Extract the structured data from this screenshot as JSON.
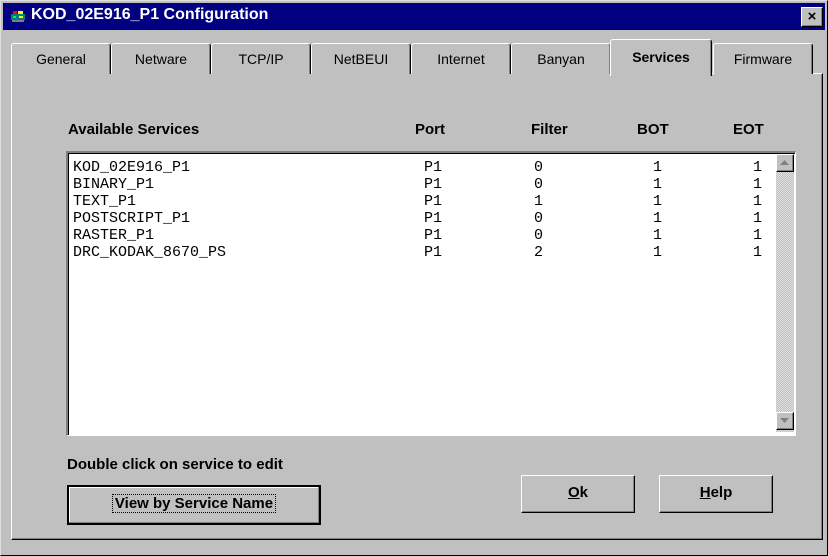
{
  "window": {
    "title": "KOD_02E916_P1 Configuration",
    "close_label": "×",
    "icon": "printer-icon"
  },
  "tabs": [
    {
      "label": "General",
      "active": false
    },
    {
      "label": "Netware",
      "active": false
    },
    {
      "label": "TCP/IP",
      "active": false
    },
    {
      "label": "NetBEUI",
      "active": false
    },
    {
      "label": "Internet",
      "active": false
    },
    {
      "label": "Banyan",
      "active": false
    },
    {
      "label": "Services",
      "active": true
    },
    {
      "label": "Firmware",
      "active": false
    }
  ],
  "services": {
    "headers": {
      "name": "Available Services",
      "port": "Port",
      "filter": "Filter",
      "bot": "BOT",
      "eot": "EOT"
    },
    "rows": [
      {
        "name": "KOD_02E916_P1",
        "port": "P1",
        "filter": "0",
        "bot": "1",
        "eot": "1"
      },
      {
        "name": "BINARY_P1",
        "port": "P1",
        "filter": "0",
        "bot": "1",
        "eot": "1"
      },
      {
        "name": "TEXT_P1",
        "port": "P1",
        "filter": "1",
        "bot": "1",
        "eot": "1"
      },
      {
        "name": "POSTSCRIPT_P1",
        "port": "P1",
        "filter": "0",
        "bot": "1",
        "eot": "1"
      },
      {
        "name": "RASTER_P1",
        "port": "P1",
        "filter": "0",
        "bot": "1",
        "eot": "1"
      },
      {
        "name": "DRC_KODAK_8670_PS",
        "port": "P1",
        "filter": "2",
        "bot": "1",
        "eot": "1"
      }
    ],
    "hint": "Double click on service to edit"
  },
  "buttons": {
    "view_by": "View by Service Name",
    "ok_mnemonic": "O",
    "ok_rest": "k",
    "help_mnemonic": "H",
    "help_rest": "elp"
  },
  "colors": {
    "titlebar": "#000080",
    "face": "#c0c0c0"
  }
}
